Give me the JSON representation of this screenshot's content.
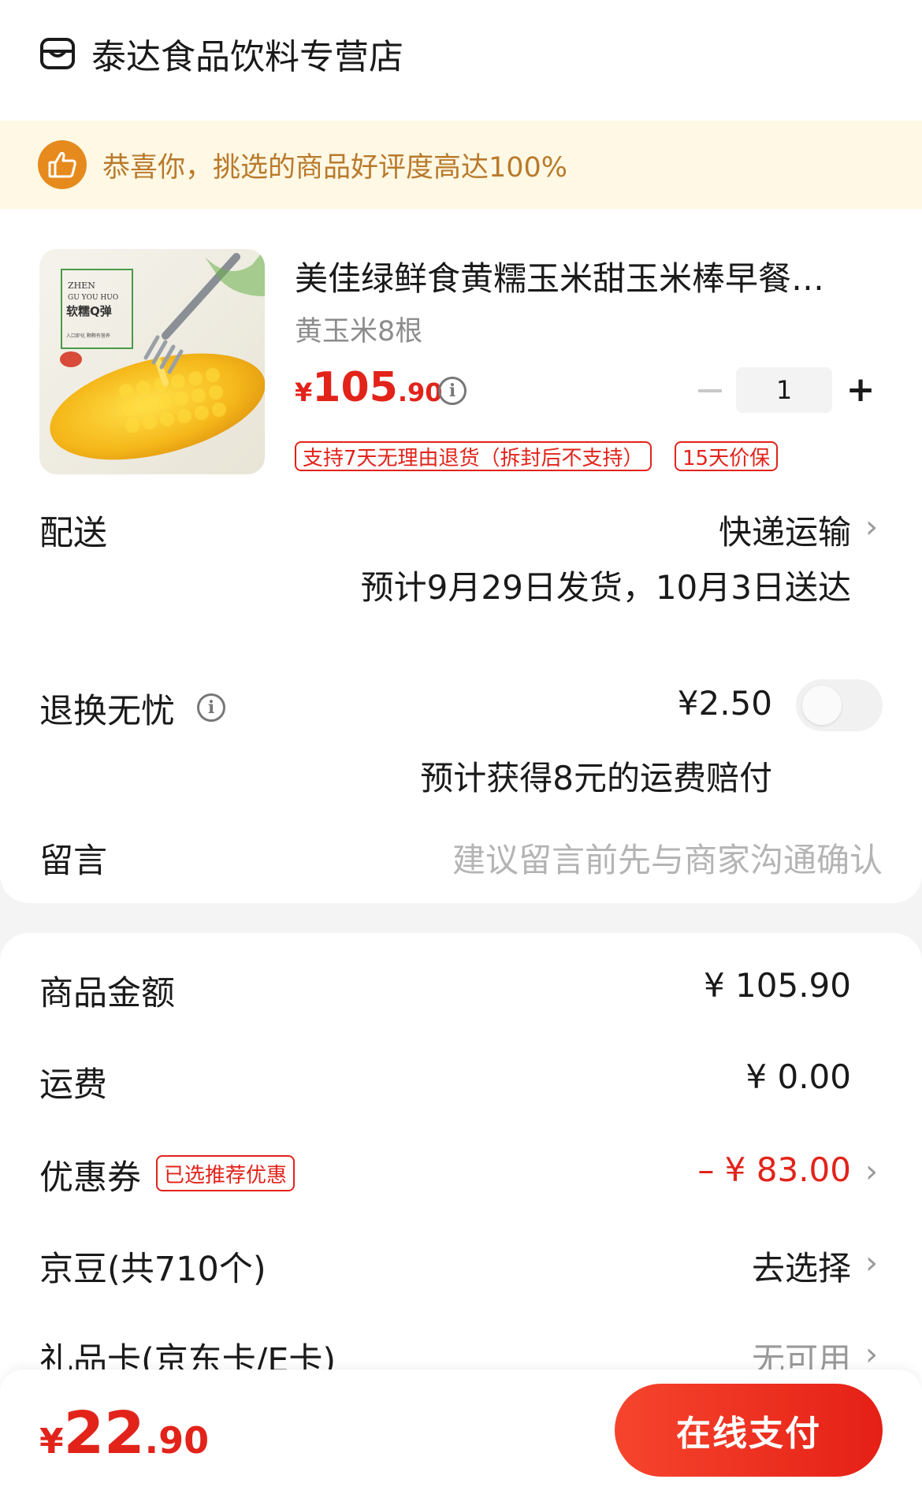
{
  "store": {
    "name": "泰达食品饮料专营店",
    "icon": "store-icon"
  },
  "rating_banner": {
    "text": "恭喜你，挑选的商品好评度高达100%",
    "icon": "thumbs-up-icon",
    "bg": "#fff8e4",
    "text_color": "#b97a2c"
  },
  "product": {
    "title": "美佳绿鲜食黄糯玉米甜玉米棒早餐…",
    "spec": "黄玉米8根",
    "price_symbol": "¥",
    "price_int": "105",
    "price_dec": ".90",
    "quantity": "1",
    "tags": [
      "支持7天无理由退货（拆封后不支持）",
      "15天价保"
    ],
    "image_text": {
      "line1": "ZHEN",
      "line2": "GU YOU HUO",
      "line3": "软糯Q弹",
      "line4": "入口即化 颗颗有营养"
    }
  },
  "delivery": {
    "label": "配送",
    "method": "快递运输",
    "estimate": "预计9月29日发货，10月3日送达"
  },
  "return_service": {
    "label": "退换无忧",
    "price": "¥2.50",
    "note": "预计获得8元的运费赔付",
    "enabled": false
  },
  "message": {
    "label": "留言",
    "placeholder": "建议留言前先与商家沟通确认"
  },
  "summary": {
    "goods_label": "商品金额",
    "goods_value": "¥ 105.90",
    "shipping_label": "运费",
    "shipping_value": "¥ 0.00",
    "coupon_label": "优惠券",
    "coupon_badge": "已选推荐优惠",
    "coupon_value": "– ¥ 83.00",
    "jingdou_label": "京豆(共710个)",
    "jingdou_value": "去选择",
    "giftcard_label": "礼品卡(京东卡/E卡)",
    "giftcard_value": "无可用"
  },
  "footer": {
    "total_symbol": "¥",
    "total_int": "22",
    "total_dec": ".90",
    "pay_label": "在线支付"
  },
  "colors": {
    "accent": "#e2231a",
    "pay_button": "#f0382a"
  }
}
